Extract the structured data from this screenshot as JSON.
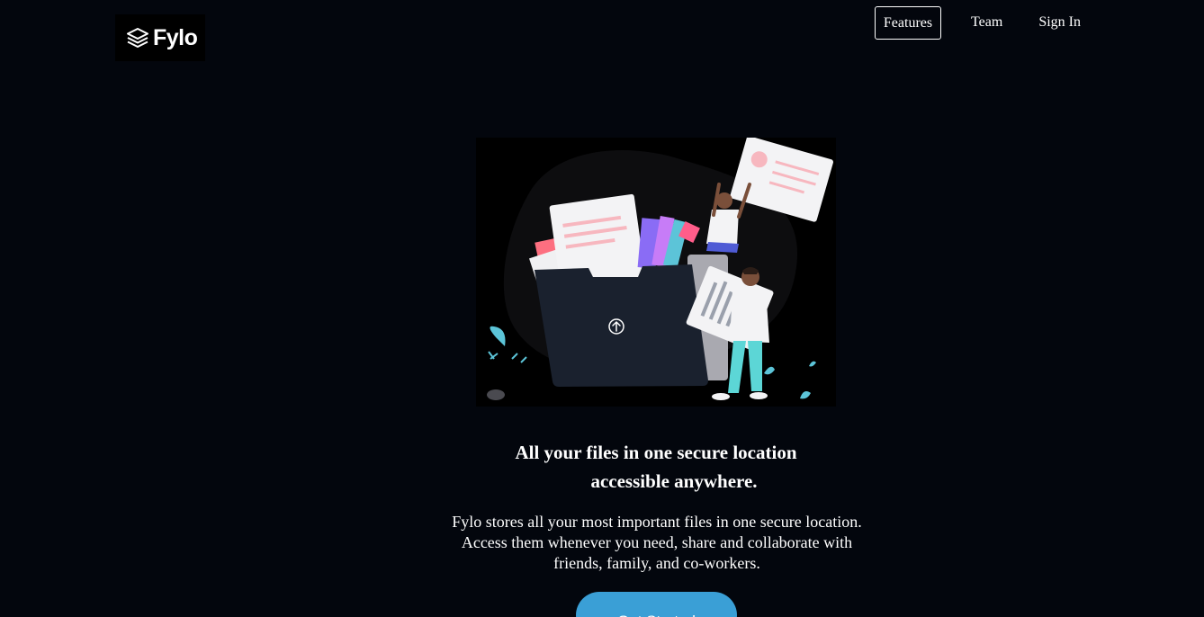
{
  "brand": {
    "name": "Fylo",
    "icon": "stacked-layers-icon"
  },
  "nav": {
    "features": "Features",
    "team": "Team",
    "sign_in": "Sign In"
  },
  "hero": {
    "illustration_icon": "upload-arrow-icon",
    "headline_line1": "All your files in one secure location",
    "headline_line2": "accessible anywhere.",
    "description_line1": "Fylo stores all your most important files in one secure location.",
    "description_line2": "Access them whenever you need, share and collaborate with",
    "description_line3": "friends, family, and co-workers.",
    "cta": "Get Started"
  },
  "colors": {
    "background": "#03060d",
    "accent": "#3a9fd6",
    "folder": "#1a212e"
  }
}
